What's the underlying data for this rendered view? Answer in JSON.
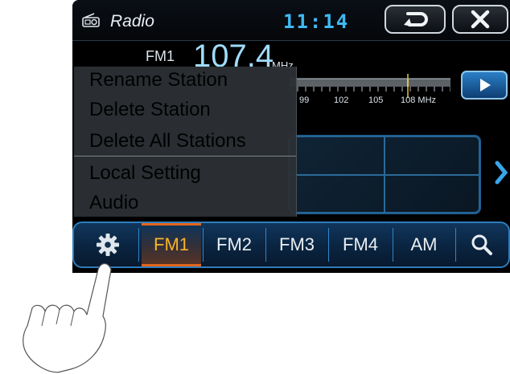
{
  "header": {
    "title": "Radio",
    "clock": "11:14",
    "icons": {
      "app": "radio-icon",
      "back": "back-arrow-icon",
      "close": "close-icon"
    }
  },
  "tuner": {
    "band": "FM1",
    "frequency": "107.4",
    "unit": "MHz",
    "dial_labels": [
      "99",
      "102",
      "105",
      "108 MHz"
    ],
    "play_icon": "play-icon"
  },
  "context_menu": {
    "items": [
      {
        "label": "Rename Station",
        "enabled": false
      },
      {
        "label": "Delete Station",
        "enabled": false
      },
      {
        "label": "Delete All Stations",
        "enabled": true
      },
      {
        "label": "Local Setting",
        "enabled": true
      },
      {
        "label": "Audio",
        "enabled": true
      }
    ]
  },
  "bottom_bar": {
    "settings_icon": "gear-icon",
    "tabs": [
      {
        "label": "FM1",
        "active": true
      },
      {
        "label": "FM2",
        "active": false
      },
      {
        "label": "FM3",
        "active": false
      },
      {
        "label": "FM4",
        "active": false
      },
      {
        "label": "AM",
        "active": false
      }
    ],
    "search_icon": "search-icon"
  },
  "colors": {
    "accent_blue": "#3fb9f2",
    "active_tab": "#f7b32c",
    "active_tab_border": "#e2661e"
  }
}
